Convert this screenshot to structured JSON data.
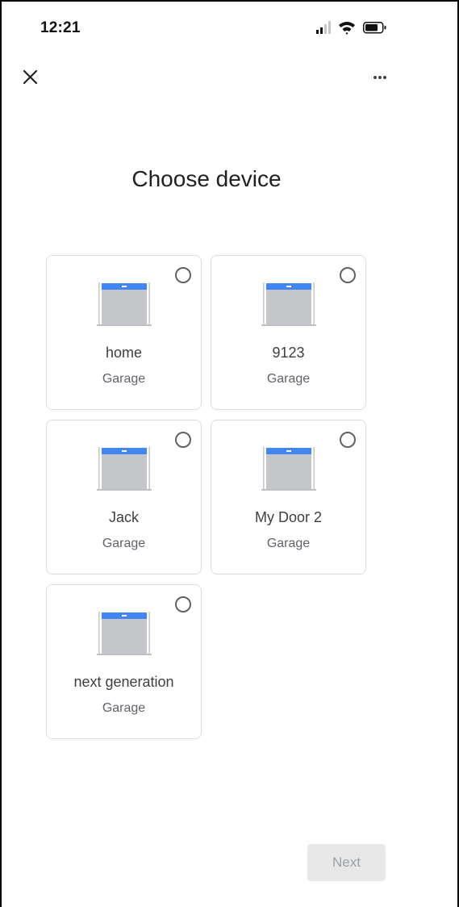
{
  "status_bar": {
    "time": "12:21"
  },
  "toolbar": {
    "close_icon": "close-icon",
    "more_icon": "more-horizontal-icon"
  },
  "page": {
    "title": "Choose device"
  },
  "devices": [
    {
      "name": "home",
      "type": "Garage",
      "selected": false
    },
    {
      "name": "9123",
      "type": "Garage",
      "selected": false
    },
    {
      "name": "Jack",
      "type": "Garage",
      "selected": false
    },
    {
      "name": "My Door 2",
      "type": "Garage",
      "selected": false
    },
    {
      "name": "next generation",
      "type": "Garage",
      "selected": false
    }
  ],
  "actions": {
    "next_label": "Next",
    "next_enabled": false
  },
  "colors": {
    "garage_door_top": "#4285f4",
    "garage_door_body": "#c4c6c9",
    "next_button_bg": "#e8e8e8",
    "next_button_text": "#9aa0a6"
  }
}
